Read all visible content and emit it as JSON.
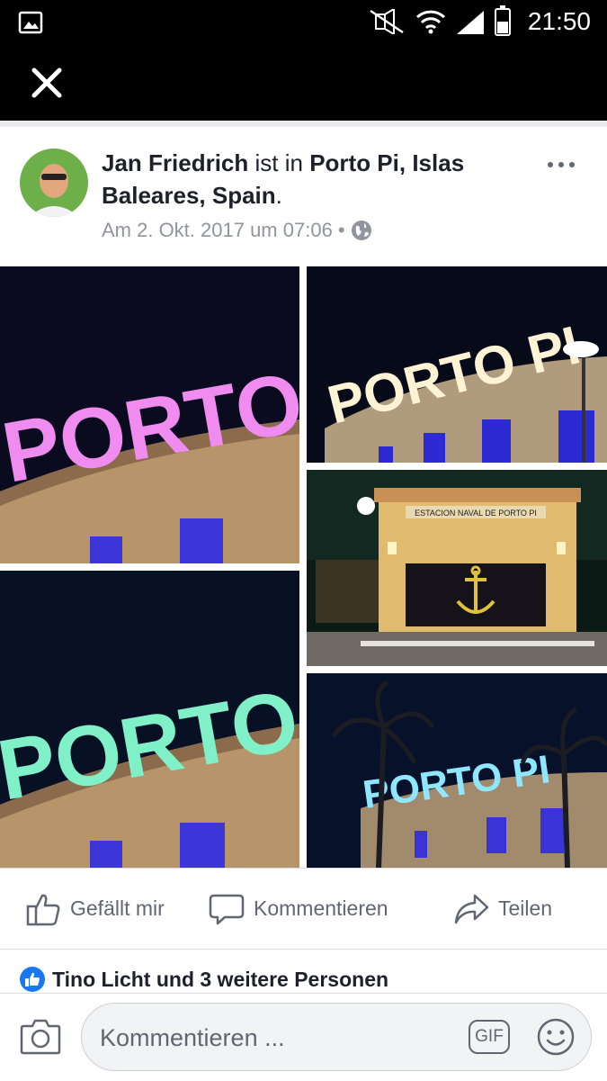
{
  "statusbar": {
    "time": "21:50"
  },
  "post": {
    "author": "Jan Friedrich",
    "connector": " ist in ",
    "location": "Porto Pi, Islas Baleares, Spain",
    "suffix": ".",
    "timestamp": "Am 2. Okt. 2017 um 07:06",
    "separator": " • ",
    "privacy_icon": "globe-icon"
  },
  "photos": [
    {
      "sign": "PORTO PI",
      "glow": "#f08cf0",
      "description": "pink"
    },
    {
      "sign": "PORTO PI",
      "glow": "#fff3d6"
    },
    {
      "gate_sign": "ESTACION NAVAL DE PORTO PI"
    },
    {
      "sign": "PORTO PI",
      "glow": "#7ff0c8"
    },
    {
      "sign": "PORTO PI",
      "glow": "#8fe6ff"
    }
  ],
  "actions": {
    "like": "Gefällt mir",
    "comment": "Kommentieren",
    "share": "Teilen"
  },
  "likes_summary": "Tino Licht und 3 weitere Personen",
  "composer": {
    "placeholder": "Kommentieren ...",
    "gif_label": "GIF"
  },
  "colors": {
    "facebook_blue": "#1877f2",
    "text_dark": "#1d2129",
    "text_muted": "#90949c"
  }
}
